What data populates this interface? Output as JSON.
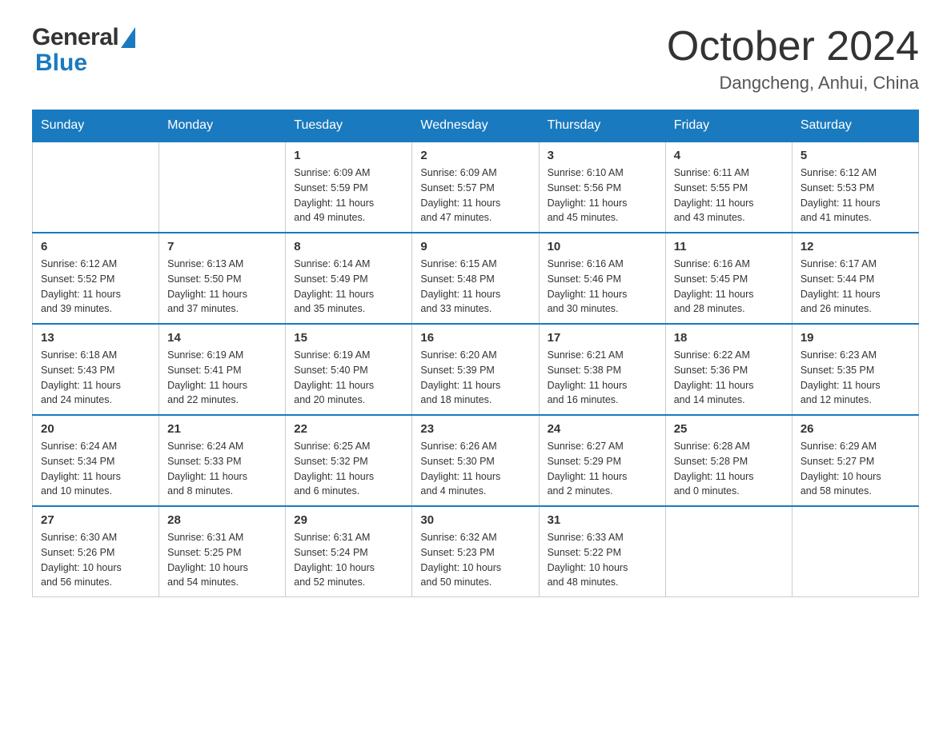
{
  "header": {
    "title": "October 2024",
    "subtitle": "Dangcheng, Anhui, China",
    "logo_general": "General",
    "logo_blue": "Blue"
  },
  "days_of_week": [
    "Sunday",
    "Monday",
    "Tuesday",
    "Wednesday",
    "Thursday",
    "Friday",
    "Saturday"
  ],
  "weeks": [
    [
      {
        "day": "",
        "info": ""
      },
      {
        "day": "",
        "info": ""
      },
      {
        "day": "1",
        "info": "Sunrise: 6:09 AM\nSunset: 5:59 PM\nDaylight: 11 hours\nand 49 minutes."
      },
      {
        "day": "2",
        "info": "Sunrise: 6:09 AM\nSunset: 5:57 PM\nDaylight: 11 hours\nand 47 minutes."
      },
      {
        "day": "3",
        "info": "Sunrise: 6:10 AM\nSunset: 5:56 PM\nDaylight: 11 hours\nand 45 minutes."
      },
      {
        "day": "4",
        "info": "Sunrise: 6:11 AM\nSunset: 5:55 PM\nDaylight: 11 hours\nand 43 minutes."
      },
      {
        "day": "5",
        "info": "Sunrise: 6:12 AM\nSunset: 5:53 PM\nDaylight: 11 hours\nand 41 minutes."
      }
    ],
    [
      {
        "day": "6",
        "info": "Sunrise: 6:12 AM\nSunset: 5:52 PM\nDaylight: 11 hours\nand 39 minutes."
      },
      {
        "day": "7",
        "info": "Sunrise: 6:13 AM\nSunset: 5:50 PM\nDaylight: 11 hours\nand 37 minutes."
      },
      {
        "day": "8",
        "info": "Sunrise: 6:14 AM\nSunset: 5:49 PM\nDaylight: 11 hours\nand 35 minutes."
      },
      {
        "day": "9",
        "info": "Sunrise: 6:15 AM\nSunset: 5:48 PM\nDaylight: 11 hours\nand 33 minutes."
      },
      {
        "day": "10",
        "info": "Sunrise: 6:16 AM\nSunset: 5:46 PM\nDaylight: 11 hours\nand 30 minutes."
      },
      {
        "day": "11",
        "info": "Sunrise: 6:16 AM\nSunset: 5:45 PM\nDaylight: 11 hours\nand 28 minutes."
      },
      {
        "day": "12",
        "info": "Sunrise: 6:17 AM\nSunset: 5:44 PM\nDaylight: 11 hours\nand 26 minutes."
      }
    ],
    [
      {
        "day": "13",
        "info": "Sunrise: 6:18 AM\nSunset: 5:43 PM\nDaylight: 11 hours\nand 24 minutes."
      },
      {
        "day": "14",
        "info": "Sunrise: 6:19 AM\nSunset: 5:41 PM\nDaylight: 11 hours\nand 22 minutes."
      },
      {
        "day": "15",
        "info": "Sunrise: 6:19 AM\nSunset: 5:40 PM\nDaylight: 11 hours\nand 20 minutes."
      },
      {
        "day": "16",
        "info": "Sunrise: 6:20 AM\nSunset: 5:39 PM\nDaylight: 11 hours\nand 18 minutes."
      },
      {
        "day": "17",
        "info": "Sunrise: 6:21 AM\nSunset: 5:38 PM\nDaylight: 11 hours\nand 16 minutes."
      },
      {
        "day": "18",
        "info": "Sunrise: 6:22 AM\nSunset: 5:36 PM\nDaylight: 11 hours\nand 14 minutes."
      },
      {
        "day": "19",
        "info": "Sunrise: 6:23 AM\nSunset: 5:35 PM\nDaylight: 11 hours\nand 12 minutes."
      }
    ],
    [
      {
        "day": "20",
        "info": "Sunrise: 6:24 AM\nSunset: 5:34 PM\nDaylight: 11 hours\nand 10 minutes."
      },
      {
        "day": "21",
        "info": "Sunrise: 6:24 AM\nSunset: 5:33 PM\nDaylight: 11 hours\nand 8 minutes."
      },
      {
        "day": "22",
        "info": "Sunrise: 6:25 AM\nSunset: 5:32 PM\nDaylight: 11 hours\nand 6 minutes."
      },
      {
        "day": "23",
        "info": "Sunrise: 6:26 AM\nSunset: 5:30 PM\nDaylight: 11 hours\nand 4 minutes."
      },
      {
        "day": "24",
        "info": "Sunrise: 6:27 AM\nSunset: 5:29 PM\nDaylight: 11 hours\nand 2 minutes."
      },
      {
        "day": "25",
        "info": "Sunrise: 6:28 AM\nSunset: 5:28 PM\nDaylight: 11 hours\nand 0 minutes."
      },
      {
        "day": "26",
        "info": "Sunrise: 6:29 AM\nSunset: 5:27 PM\nDaylight: 10 hours\nand 58 minutes."
      }
    ],
    [
      {
        "day": "27",
        "info": "Sunrise: 6:30 AM\nSunset: 5:26 PM\nDaylight: 10 hours\nand 56 minutes."
      },
      {
        "day": "28",
        "info": "Sunrise: 6:31 AM\nSunset: 5:25 PM\nDaylight: 10 hours\nand 54 minutes."
      },
      {
        "day": "29",
        "info": "Sunrise: 6:31 AM\nSunset: 5:24 PM\nDaylight: 10 hours\nand 52 minutes."
      },
      {
        "day": "30",
        "info": "Sunrise: 6:32 AM\nSunset: 5:23 PM\nDaylight: 10 hours\nand 50 minutes."
      },
      {
        "day": "31",
        "info": "Sunrise: 6:33 AM\nSunset: 5:22 PM\nDaylight: 10 hours\nand 48 minutes."
      },
      {
        "day": "",
        "info": ""
      },
      {
        "day": "",
        "info": ""
      }
    ]
  ]
}
